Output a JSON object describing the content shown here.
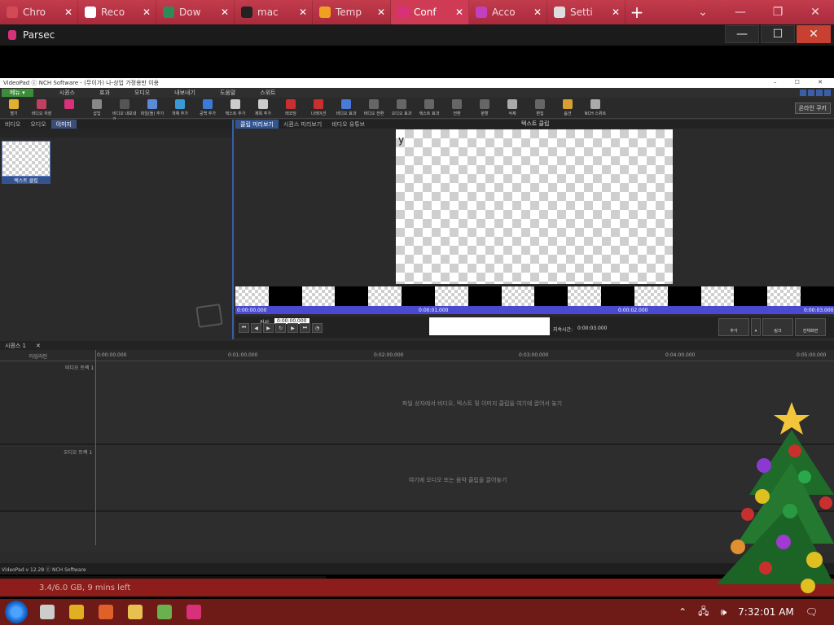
{
  "browser": {
    "tabs": [
      {
        "label": "Chro",
        "color": "#d34a57"
      },
      {
        "label": "Reco",
        "color": "#ffffff"
      },
      {
        "label": "Dow",
        "color": "#2e8b57"
      },
      {
        "label": "mac",
        "color": "#222222"
      },
      {
        "label": "Temp",
        "color": "#f0a020"
      },
      {
        "label": "Conf",
        "color": "#d9307a",
        "active": true
      },
      {
        "label": "Acco",
        "color": "#c040c0"
      },
      {
        "label": "Setti",
        "color": "#dddddd"
      }
    ],
    "new_tab": "+",
    "controls": [
      "⌄",
      "—",
      "❐",
      "✕"
    ]
  },
  "parsec": {
    "title": "Parsec",
    "buttons": [
      "—",
      "☐",
      "✕"
    ]
  },
  "videopad": {
    "title": "VideoPad ⓒ NCH Software - (무이가) 나-상업 가정용만 이용",
    "window_controls": "– ☐ ✕",
    "menu_button": "메뉴 ▾",
    "menu": [
      "시퀀스",
      "효과",
      "오디오",
      "내보내기",
      "도움말",
      "스위트"
    ],
    "toolbar": [
      {
        "label": "열기",
        "color": "#e0b030"
      },
      {
        "label": "비디오 저장",
        "color": "#c04060"
      },
      {
        "label": "",
        "color": "#d9307a"
      },
      {
        "label": "삽입",
        "color": "#888888"
      },
      {
        "label": "비디오 내보내기",
        "color": "#555555"
      },
      {
        "label": "파일(들) 추가",
        "color": "#5a8ad8"
      },
      {
        "label": "개체 추가",
        "color": "#3a9ad8"
      },
      {
        "label": "공백 추가",
        "color": "#3a7ad8"
      },
      {
        "label": "텍스트 추가",
        "color": "#cccccc"
      },
      {
        "label": "제목 추가",
        "color": "#cccccc"
      },
      {
        "label": "레코딩",
        "color": "#c83030"
      },
      {
        "label": "나레이션",
        "color": "#c83030"
      },
      {
        "label": "비디오 효과",
        "color": "#4a7ad8"
      },
      {
        "label": "비디오 전환",
        "color": "#666666"
      },
      {
        "label": "오디오 효과",
        "color": "#666666"
      },
      {
        "label": "텍스트 효과",
        "color": "#666666"
      },
      {
        "label": "전환",
        "color": "#666666"
      },
      {
        "label": "분할",
        "color": "#666666"
      },
      {
        "label": "삭제",
        "color": "#aaaaaa"
      },
      {
        "label": "편집",
        "color": "#666666"
      },
      {
        "label": "옵션",
        "color": "#d8a030"
      },
      {
        "label": "NCH 스위트",
        "color": "#aaaaaa"
      }
    ],
    "online_button": "온라인 쿠키",
    "bin_tabs": [
      "비디오",
      "오디오",
      "이미지"
    ],
    "clip_label": "텍스트 클립",
    "preview_tabs": [
      "클립 미리보기",
      "시퀀스 미리보기",
      "비디오 유튜브"
    ],
    "preview_title": "텍스트 클립",
    "canvas_text": "y",
    "time_labels": [
      "0:00:00.000",
      "0:00:01.000",
      "0:00:02.000",
      "0:00:03.000"
    ],
    "cursor_label": "커서:",
    "cursor_value": "0:00:00.000",
    "duration_label": "지속시간:",
    "duration_value": "0:00:03.000",
    "right_buttons": [
      "추가",
      "링크",
      "전체화면"
    ],
    "timeline_tab": "시퀀스 1",
    "timeline_tab_close": "✕",
    "timeline_label": "타임라인",
    "ruler": [
      "0:00:00.000",
      "0:01:00.000",
      "0:02:00.000",
      "0:03:00.000",
      "0:04:00.000",
      "0:05:00.000"
    ],
    "video_track": "비디오 트랙 1",
    "video_hint": "파일 상자에서 비디오, 텍스트 및 이미지 클립을 여기에 끌어서 놓기",
    "audio_track": "오디오 트랙 1",
    "audio_hint": "여기에 오디오 또는 음악 클립을 끌어놓기",
    "status": "VideoPad v 12.28 ⓒ NCH Software"
  },
  "remote_taskbar": [
    "#1e6fd9",
    "#e0c040",
    "#553333",
    "#1a8cd8",
    "#8ad",
    "#1a8cd8",
    "#1a8cd8",
    "#1a5a9a",
    "#ccc",
    "#ccc",
    "#e06020",
    "#ccc",
    "#e0e0e0",
    "#2aa8d8",
    "#d9307a",
    "#d8b030"
  ],
  "host_footer": "3.4/6.0 GB, 9 mins left",
  "taskbar": {
    "icons": [
      {
        "name": "task-view-icon",
        "color": "#cccccc"
      },
      {
        "name": "chrome-icon",
        "color": "#e0b020"
      },
      {
        "name": "firefox-icon",
        "color": "#e0602a"
      },
      {
        "name": "explorer-icon",
        "color": "#e8c050"
      },
      {
        "name": "app-icon",
        "color": "#6ab04c"
      },
      {
        "name": "parsec-icon",
        "color": "#d9307a"
      }
    ],
    "clock": "7:32:01 AM",
    "tray_glyphs": [
      "⌃",
      "🖧",
      "🕪",
      "🗨"
    ]
  }
}
